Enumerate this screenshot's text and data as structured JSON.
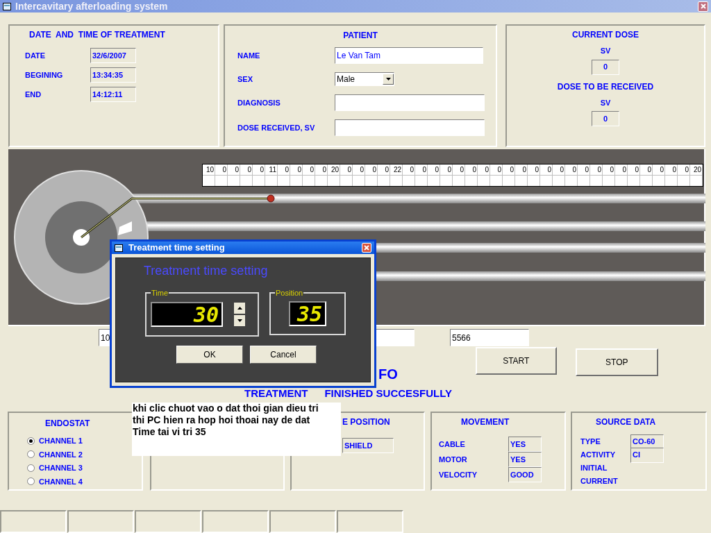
{
  "window": {
    "title": "Intercavitary afterloading system"
  },
  "treatment_time": {
    "title": "DATE  AND  TIME OF TREATMENT",
    "fields": [
      {
        "label": "DATE",
        "value": "32/6/2007"
      },
      {
        "label": "BEGINING",
        "value": "13:34:35"
      },
      {
        "label": "END",
        "value": "14:12:11"
      }
    ]
  },
  "patient": {
    "title": "PATIENT",
    "name": {
      "label": "NAME",
      "value": "Le Van Tam"
    },
    "sex": {
      "label": "SEX",
      "value": "Male"
    },
    "diagnosis": {
      "label": "DIAGNOSIS"
    },
    "dose_received": {
      "label": "DOSE RECEIVED, SV"
    }
  },
  "dose": {
    "current_title": "CURRENT DOSE",
    "current_unit": "SV",
    "current_value": "0",
    "target_title": "DOSE TO BE RECEIVED",
    "target_unit": "SV",
    "target_value": "0"
  },
  "position_table": {
    "values": [
      "10",
      "0",
      "0",
      "0",
      "0",
      "11",
      "0",
      "0",
      "0",
      "0",
      "20",
      "0",
      "0",
      "0",
      "0",
      "22",
      "0",
      "0",
      "0",
      "0",
      "0",
      "0",
      "0",
      "0",
      "0",
      "0",
      "0",
      "0",
      "0",
      "0",
      "0",
      "0",
      "0",
      "0",
      "0",
      "0",
      "0",
      "0",
      "0",
      "20"
    ]
  },
  "time_field": {
    "value": "10"
  },
  "code_field": {
    "value": "5566"
  },
  "buttons": [
    "START",
    "STOP"
  ],
  "info": {
    "title_fragment": "FO",
    "status_label": "TREATMENT",
    "status": "FINISHED SUCCESFULLY"
  },
  "endostat": {
    "title": "ENDOSTAT",
    "channels": [
      {
        "label": "CHANNEL 1",
        "selected": true
      },
      {
        "label": "CHANNEL 2",
        "selected": false
      },
      {
        "label": "CHANNEL 3",
        "selected": false
      },
      {
        "label": "CHANNEL 4",
        "selected": false
      }
    ]
  },
  "source_position": {
    "title": "E POSITION",
    "value": "SHIELD"
  },
  "movement": {
    "title": "MOVEMENT",
    "rows": [
      {
        "label": "CABLE",
        "value": "YES"
      },
      {
        "label": "MOTOR",
        "value": "YES"
      },
      {
        "label": "VELOCITY",
        "value": "GOOD"
      }
    ]
  },
  "source_data": {
    "title": "SOURCE DATA",
    "rows": [
      {
        "label": "TYPE",
        "value": "CO-60"
      },
      {
        "label": "ACTIVITY",
        "value": "CI"
      },
      {
        "label": "INITIAL"
      },
      {
        "label": "CURRENT"
      }
    ]
  },
  "dialog": {
    "title": "Treatment time setting",
    "heading": "Treatment time setting",
    "time": {
      "label": "Time",
      "value": "30"
    },
    "position": {
      "label": "Position",
      "value": "35"
    },
    "buttons": [
      "OK",
      "Cancel"
    ]
  },
  "annotation": "khi clic chuot vao o dat thoi gian dieu tri thi PC hien ra hop hoi thoai nay de dat Time tai vi tri 35"
}
